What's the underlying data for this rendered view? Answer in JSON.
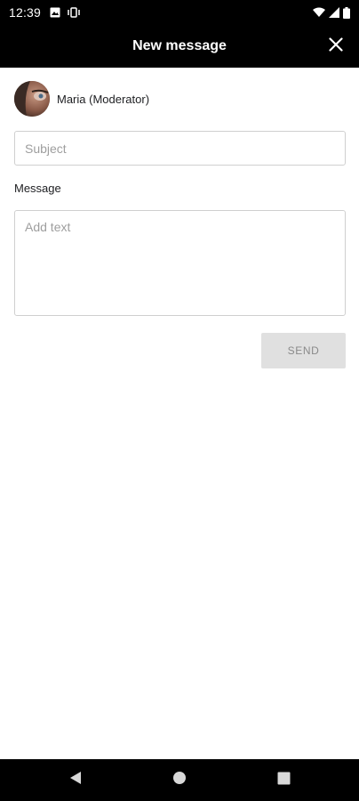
{
  "status_bar": {
    "time": "12:39",
    "left_icons": [
      "notification-photo-icon",
      "vibrate-icon"
    ],
    "right_icons": [
      "wifi-icon",
      "cell-signal-icon",
      "battery-icon"
    ]
  },
  "app_bar": {
    "title": "New message",
    "close_icon": "close-icon"
  },
  "recipient": {
    "name": "Maria (Moderator)",
    "avatar": "avatar"
  },
  "subject": {
    "placeholder": "Subject",
    "value": ""
  },
  "message": {
    "label": "Message",
    "placeholder": "Add text",
    "value": ""
  },
  "send_button": {
    "label": "SEND",
    "enabled": false
  },
  "nav_bar": {
    "buttons": [
      "back-icon",
      "home-icon",
      "recents-icon"
    ]
  },
  "colors": {
    "bar_background": "#000000",
    "page_background": "#ffffff",
    "disabled_button_bg": "#e0e0e0",
    "disabled_button_text": "#8a8a8a",
    "field_border": "#cfcfcf"
  }
}
